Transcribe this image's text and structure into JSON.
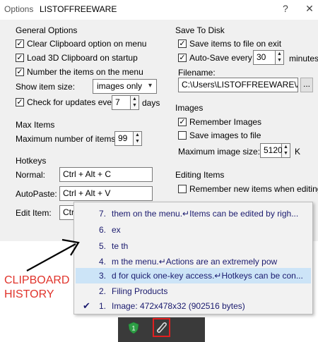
{
  "titlebar": {
    "options_label": "Options",
    "app_title": "LISTOFFREEWARE",
    "help_glyph": "?",
    "close_glyph": "✕"
  },
  "general": {
    "title": "General Options",
    "clear_clipboard": "Clear Clipboard option on menu",
    "load_3d": "Load 3D Clipboard on startup",
    "number_items": "Number the items on the menu",
    "show_item_size_label": "Show item size:",
    "show_item_size_value": "images only",
    "check_updates_label": "Check for updates every",
    "check_updates_value": "7",
    "check_updates_unit": "days"
  },
  "max_items": {
    "title": "Max Items",
    "label": "Maximum number of items:",
    "value": "99"
  },
  "hotkeys": {
    "title": "Hotkeys",
    "normal_label": "Normal:",
    "normal_value": "Ctrl + Alt + C",
    "autopaste_label": "AutoPaste:",
    "autopaste_value": "Ctrl + Alt + V",
    "edit_label": "Edit Item:",
    "edit_value": "Ctrl"
  },
  "save_to_disk": {
    "title": "Save To Disk",
    "save_on_exit": "Save items to file on exit",
    "autosave_label": "Auto-Save every",
    "autosave_value": "30",
    "autosave_unit": "minutes",
    "filename_label": "Filename:",
    "filename_value": "C:\\Users\\LISTOFFREEWARE\\Ap",
    "browse_label": "..."
  },
  "images": {
    "title": "Images",
    "remember_images": "Remember Images",
    "save_images": "Save images to file",
    "max_size_label": "Maximum image size:",
    "max_size_value": "5120",
    "max_size_unit": "K"
  },
  "editing": {
    "title": "Editing Items",
    "remember_new": "Remember new items when editing"
  },
  "menu": {
    "items": [
      {
        "num": "7.",
        "text": "them on the menu.↵Items can be edited by righ..."
      },
      {
        "num": "6.",
        "text": "ex"
      },
      {
        "num": "5.",
        "text": "te th"
      },
      {
        "num": "4.",
        "text": "m the menu.↵Actions are an extremely pow"
      },
      {
        "num": "3.",
        "text": "d for quick one-key access.↵Hotkeys can be con..."
      },
      {
        "num": "2.",
        "text": "Filing Products"
      },
      {
        "num": "1.",
        "text": "Image: 472x478x32 (902516 bytes)"
      }
    ],
    "selected_index": 4,
    "checked_index": 6
  },
  "annotation": {
    "line1": "CLIPBOARD",
    "line2": "HISTORY"
  },
  "tray": {
    "badge": "1"
  },
  "colors": {
    "annotation": "#e0332b",
    "menu_text": "#1a1a6e",
    "selection": "#cce4f7",
    "highlight_box": "#e02020"
  },
  "icons": [
    "close-icon",
    "help-icon",
    "chevron-down-icon",
    "checkmark-icon",
    "shield-icon",
    "paperclip-icon",
    "arrow-icon"
  ]
}
